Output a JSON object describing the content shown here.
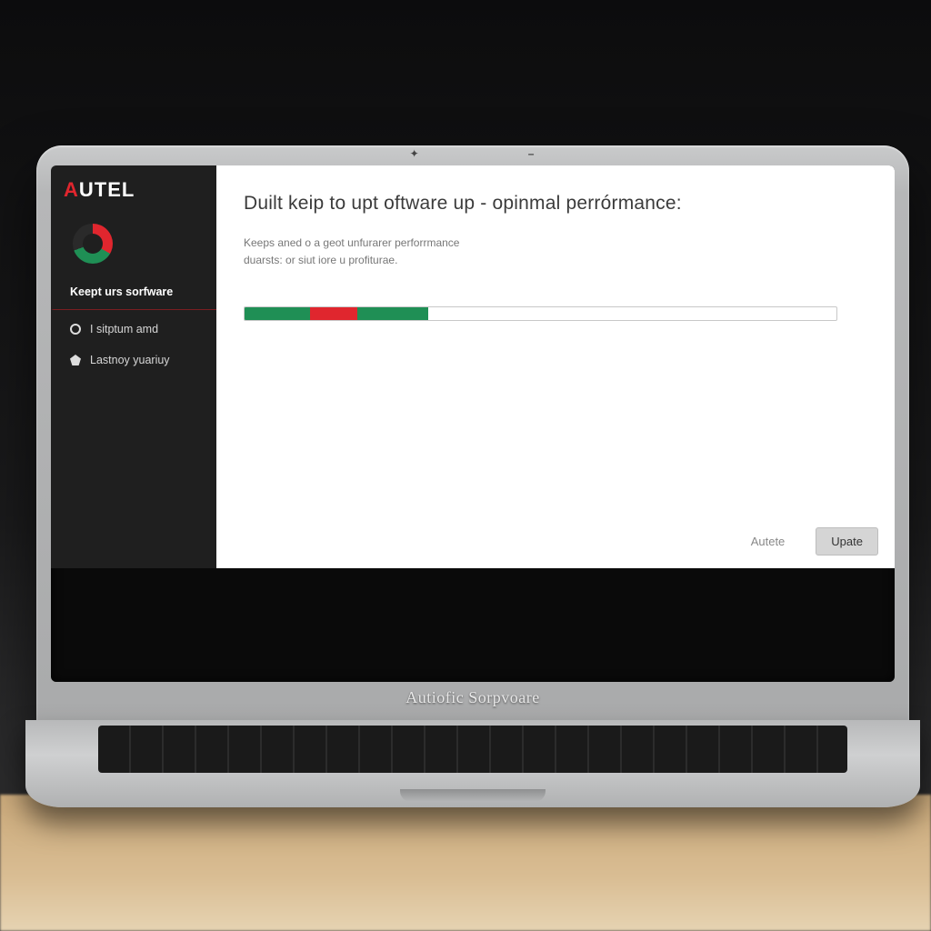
{
  "brand": {
    "accent_letter": "A",
    "rest": "UTEL"
  },
  "sidebar": {
    "items": [
      {
        "label": "Keept urs sorfware"
      },
      {
        "label": "I sitptum amd"
      },
      {
        "label": "Lastnoy yuariuy"
      }
    ]
  },
  "main": {
    "headline": "Duilt keip to upt oftware up - opinmal perrórmance:",
    "subtext_line1": "Keeps aned o a geot unfurarer perforrmance",
    "subtext_line2": "duarsts: or siut iore u profiturae.",
    "progress": {
      "segments_pct": {
        "g1": 11,
        "r": 8,
        "g2": 12
      },
      "total_pct": 31
    }
  },
  "buttons": {
    "ghost_label": "Autete",
    "primary_label": "Upate"
  },
  "hinge_brand": "Autiofic Sorpvoare",
  "colors": {
    "accent_red": "#e0262e",
    "accent_green": "#1f8f55",
    "sidebar_bg": "#1f1f1f"
  }
}
